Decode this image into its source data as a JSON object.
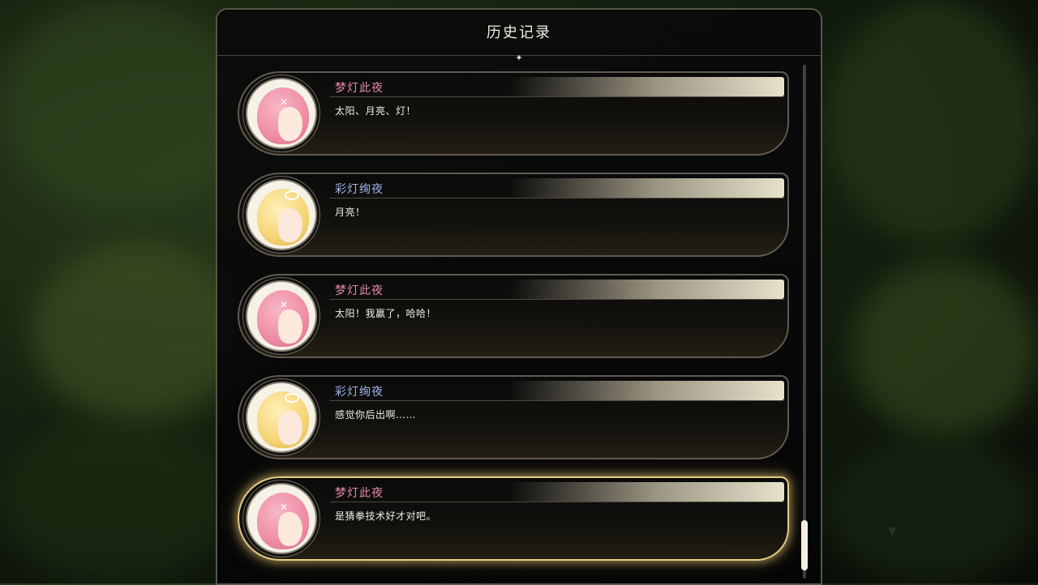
{
  "screen": {
    "title": "历史记录"
  },
  "entries": [
    {
      "speaker": "梦灯此夜",
      "text": "太阳、月亮、灯！",
      "speaker_color": "#e68aa8",
      "avatar": "pink-hair-character"
    },
    {
      "speaker": "彩灯绚夜",
      "text": "月亮！",
      "speaker_color": "#9fb4e8",
      "avatar": "blonde-hair-character"
    },
    {
      "speaker": "梦灯此夜",
      "text": "太阳！我赢了，哈哈！",
      "speaker_color": "#e68aa8",
      "avatar": "pink-hair-character"
    },
    {
      "speaker": "彩灯绚夜",
      "text": "感觉你后出啊……",
      "speaker_color": "#9fb4e8",
      "avatar": "blonde-hair-character"
    },
    {
      "speaker": "梦灯此夜",
      "text": "是猜拳技术好才对吧。",
      "speaker_color": "#e68aa8",
      "avatar": "pink-hair-character",
      "highlighted": true
    }
  ],
  "scroll": {
    "position": 1.0
  },
  "colors": {
    "accent_gold": "#e6cc86",
    "panel_border": "#5a554a"
  }
}
